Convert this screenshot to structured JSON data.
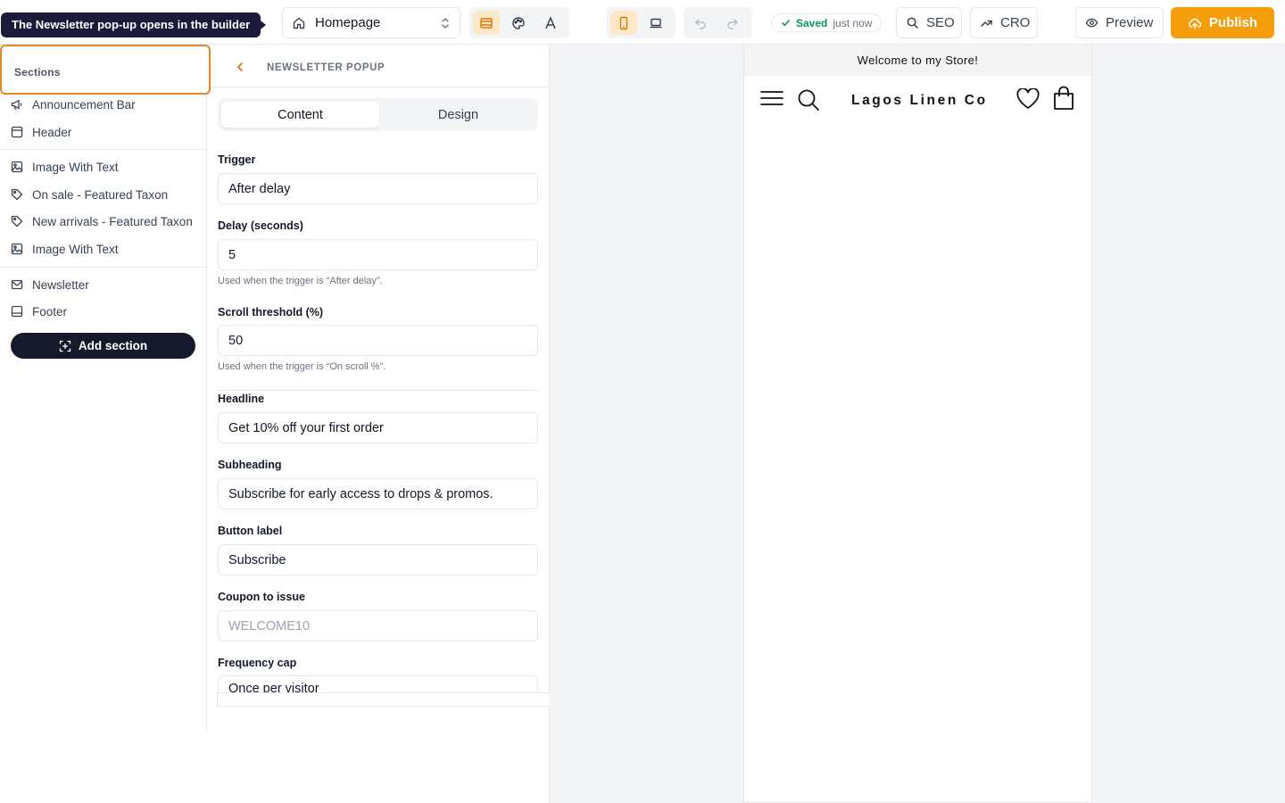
{
  "tooltip": {
    "text": "The Newsletter pop-up opens in the builder"
  },
  "topbar": {
    "page_select": {
      "label": "Homepage",
      "icon": "home-icon"
    },
    "mode_group": {
      "icons": [
        "layout-icon",
        "palette-icon",
        "typography-icon"
      ],
      "active": "layout-icon"
    },
    "device_group": {
      "icons": [
        "mobile-icon",
        "laptop-icon"
      ],
      "active": "mobile-icon"
    },
    "history_group": {
      "icons": [
        "undo-icon",
        "redo-icon"
      ]
    },
    "status": {
      "state": "Saved",
      "time": "just now",
      "color": "#059669"
    },
    "seo_label": "SEO",
    "cro_label": "CRO",
    "preview_label": "Preview",
    "publish_label": "Publish",
    "accent_color": "#f59e0b"
  },
  "sidebar": {
    "title": "Sections",
    "items": [
      {
        "label": "Announcement Bar",
        "icon": "megaphone-icon"
      },
      {
        "label": "Header",
        "icon": "header-icon"
      },
      {
        "label": "Image With Text",
        "icon": "image-icon"
      },
      {
        "label": "On sale - Featured Taxon",
        "icon": "tag-icon"
      },
      {
        "label": "New arrivals - Featured Taxon",
        "icon": "tag-icon"
      },
      {
        "label": "Image With Text",
        "icon": "image-icon"
      },
      {
        "label": "Newsletter",
        "icon": "mail-icon"
      },
      {
        "label": "Footer",
        "icon": "footer-icon"
      }
    ],
    "add_section_label": "Add section"
  },
  "settings": {
    "title": "NEWSLETTER POPUP",
    "tabs": [
      "Content",
      "Design"
    ],
    "active_tab": "Content",
    "fields": {
      "trigger": {
        "label": "Trigger",
        "value": "After delay"
      },
      "delay": {
        "label": "Delay (seconds)",
        "value": "5",
        "help": "Used when the trigger is “After delay”."
      },
      "scroll": {
        "label": "Scroll threshold (%)",
        "value": "50",
        "help": "Used when the trigger is “On scroll %”."
      },
      "headline": {
        "label": "Headline",
        "value": "Get 10% off your first order"
      },
      "subheading": {
        "label": "Subheading",
        "value": "Subscribe for early access to drops & promos."
      },
      "button_label": {
        "label": "Button label",
        "value": "Subscribe"
      },
      "coupon": {
        "label": "Coupon to issue",
        "placeholder": "WELCOME10"
      },
      "frequency": {
        "label": "Frequency cap",
        "value": "Once per visitor"
      }
    }
  },
  "preview": {
    "announcement": "Welcome to my Store!",
    "store_name": "Lagos Linen Co",
    "header_icons": [
      "menu-icon",
      "search-icon",
      "heart-icon",
      "bag-icon"
    ]
  }
}
